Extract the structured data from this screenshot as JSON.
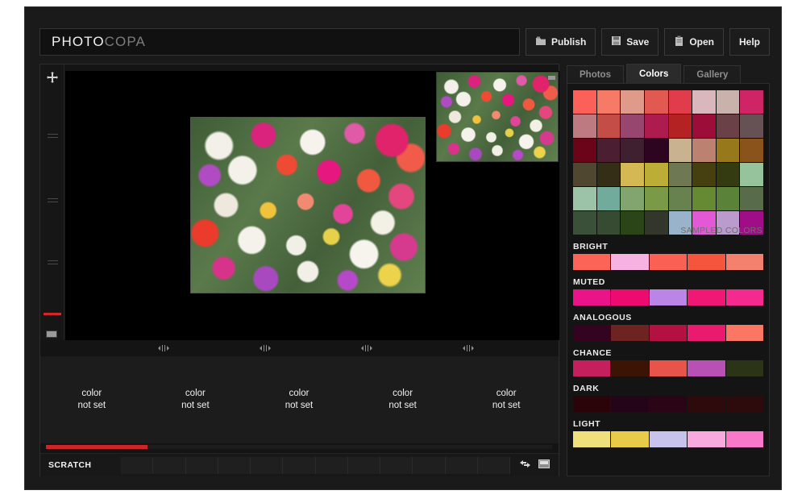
{
  "app": {
    "logo_primary": "PHOTO",
    "logo_secondary": "COPA"
  },
  "toolbar": {
    "buttons": [
      {
        "label": "Publish",
        "icon": "publish-folder-icon"
      },
      {
        "label": "Save",
        "icon": "floppy-disk-icon"
      },
      {
        "label": "Open",
        "icon": "clipboard-open-icon"
      },
      {
        "label": "Help",
        "icon": "none"
      }
    ]
  },
  "editor": {
    "rail": {
      "move_icon": "move-crosshair-icon",
      "bottom_icon": "filmstrip-icon"
    },
    "canvas": {
      "main_image_alt": "tulips-photo",
      "thumbnail_alt": "tulips-thumbnail"
    },
    "slots": [
      {
        "line1": "color",
        "line2": "not set"
      },
      {
        "line1": "color",
        "line2": "not set"
      },
      {
        "line1": "color",
        "line2": "not set"
      },
      {
        "line1": "color",
        "line2": "not set"
      },
      {
        "line1": "color",
        "line2": "not set"
      }
    ],
    "progress_percent": 20,
    "progress_color": "#cf2326",
    "scratch": {
      "label": "SCRATCH",
      "cell_count": 12,
      "tools": [
        {
          "icon": "swap-arrows-icon"
        },
        {
          "icon": "panel-toggle-icon"
        }
      ]
    }
  },
  "side": {
    "tabs": [
      {
        "label": "Photos",
        "active": false
      },
      {
        "label": "Colors",
        "active": true
      },
      {
        "label": "Gallery",
        "active": false
      }
    ],
    "sampled": {
      "caption": "SAMPLED COLORS",
      "columns": 8,
      "rows": [
        [
          "#fb6159",
          "#f77a66",
          "#e09a89",
          "#e25952",
          "#e03c4c",
          "#d9b7bd",
          "#c9b2ac",
          "#cf2566"
        ],
        [
          "#bd7a80",
          "#c44d48",
          "#96466f",
          "#ae1c4f",
          "#b42224",
          "#9d0d3a",
          "#6a4146",
          "#665254"
        ],
        [
          "#6b0418",
          "#4b1f31",
          "#3f2030",
          "#2d0520",
          "#c8b28f",
          "#bd8171",
          "#97781a",
          "#8a531c"
        ],
        [
          "#4f4730",
          "#332e15",
          "#d3b853",
          "#bbad35",
          "#6e7953",
          "#463f10",
          "#353b10",
          "#96c39b"
        ],
        [
          "#9cc3a7",
          "#71ab9c",
          "#82a46f",
          "#7a9a48",
          "#68824f",
          "#668a34",
          "#5a8238",
          "#586b4b"
        ],
        [
          "#3b5038",
          "#374b32",
          "#2b4418",
          "#33372b",
          "#9ab3cd",
          "#e258d5",
          "#bb9bce",
          "#9f0e86"
        ]
      ]
    },
    "palettes": [
      {
        "name": "BRIGHT",
        "colors": [
          "#fb6457",
          "#f7b2e2",
          "#fb6055",
          "#f4553c",
          "#f4816d"
        ]
      },
      {
        "name": "MUTED",
        "colors": [
          "#ea1387",
          "#ed0b70",
          "#bb84e7",
          "#f01775",
          "#f52a8e"
        ]
      },
      {
        "name": "ANALOGOUS",
        "colors": [
          "#33031f",
          "#6d2321",
          "#b31141",
          "#ea1a6e",
          "#fb7764"
        ]
      },
      {
        "name": "CHANCE",
        "colors": [
          "#c51f5e",
          "#3b1406",
          "#e8544a",
          "#b951b4",
          "#2c3418"
        ]
      },
      {
        "name": "DARK",
        "colors": [
          "#2b0409",
          "#240418",
          "#2b0516",
          "#2e0a0c",
          "#2d0a0c"
        ]
      },
      {
        "name": "LIGHT",
        "colors": [
          "#efe07c",
          "#e8cb47",
          "#c7c3ec",
          "#f8aade",
          "#f978c9"
        ]
      }
    ]
  }
}
